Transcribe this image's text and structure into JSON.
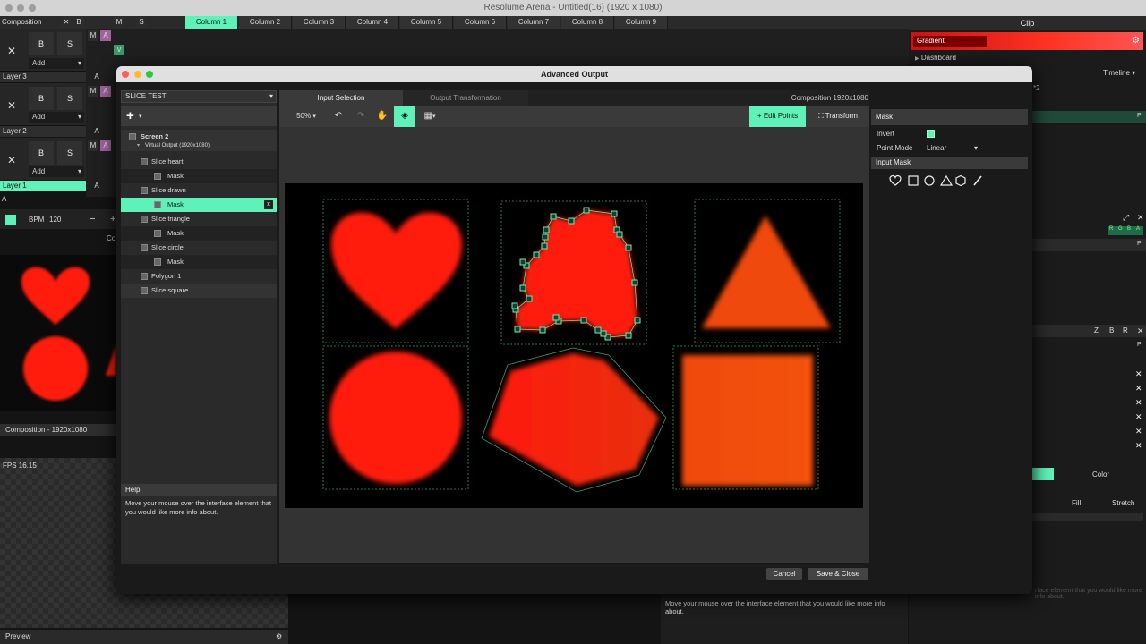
{
  "app": {
    "window_title": "Resolume Arena - Untitled(16) (1920 x 1080)"
  },
  "composition": {
    "label": "Composition",
    "x": "✕",
    "b": "B",
    "m": "M",
    "s": "S"
  },
  "columns": [
    "Column 1",
    "Column 2",
    "Column 3",
    "Column 4",
    "Column 5",
    "Column 6",
    "Column 7",
    "Column 8",
    "Column 9"
  ],
  "layers": [
    {
      "name": "Layer 3",
      "add": "Add",
      "b": "B",
      "s": "S",
      "a": "A"
    },
    {
      "name": "Layer 2",
      "add": "Add",
      "b": "B",
      "s": "S",
      "a": "A"
    },
    {
      "name": "Layer 1",
      "add": "Add",
      "b": "B",
      "s": "S",
      "a": "A"
    }
  ],
  "layer_flags": {
    "m": "M",
    "a": "A",
    "v": "V"
  },
  "bpm": {
    "label": "BPM",
    "value": "120",
    "minus": "−",
    "plus": "+"
  },
  "comp_partial": "Co",
  "comp_size_label": "Composition - 1920x1080",
  "fps_label": "FPS 16.15",
  "preview_label": "Preview",
  "clip_panel": {
    "title": "Clip",
    "gradient_label": "Gradient",
    "dashboard_label": "Dashboard",
    "timeline_label": "Timeline",
    "partial_x2": "*2",
    "rgba": [
      "R",
      "G",
      "B",
      "A"
    ],
    "zbr": [
      "Z",
      "B",
      "R"
    ],
    "color_label": "Color",
    "fill_label": "Fill",
    "stretch_label": "Stretch",
    "p_label": "P",
    "help_partial": "rface element that you would like more info about."
  },
  "dialog": {
    "title": "Advanced Output",
    "screen_select": "SLICE TEST",
    "tabs": [
      "Input Selection",
      "Output Transformation"
    ],
    "composition_res": "Composition 1920x1080",
    "zoom": "50%",
    "edit_points": "Edit Points",
    "transform": "Transform",
    "tree": [
      {
        "label": "Screen 2"
      },
      {
        "label": "Virtual Output (1920x1080)"
      },
      {
        "label": "Slice heart"
      },
      {
        "label": "Mask"
      },
      {
        "label": "Slice drawn"
      },
      {
        "label": "Mask"
      },
      {
        "label": "Slice triangle"
      },
      {
        "label": "Mask"
      },
      {
        "label": "Slice circle"
      },
      {
        "label": "Mask"
      },
      {
        "label": "Polygon 1"
      },
      {
        "label": "Slice square"
      }
    ],
    "mask_remove": "x",
    "help_title": "Help",
    "help_text": "Move your mouse over the interface element that you would like more info about.",
    "mask_panel": {
      "title": "Mask",
      "invert_label": "Invert",
      "point_mode_label": "Point Mode",
      "point_mode_value": "Linear",
      "input_mask_label": "Input Mask",
      "shape_icons": [
        "heart-icon",
        "rectangle-icon",
        "circle-icon",
        "triangle-icon",
        "hexagon-icon",
        "pen-icon"
      ]
    },
    "cancel": "Cancel",
    "save_close": "Save & Close"
  },
  "bottom_help": "Move your mouse over the interface element that you would like more info about.",
  "colors": {
    "accent": "#5ef2b8",
    "shape_red": "#ff1a0a",
    "shape_orange": "#f04a0a"
  }
}
